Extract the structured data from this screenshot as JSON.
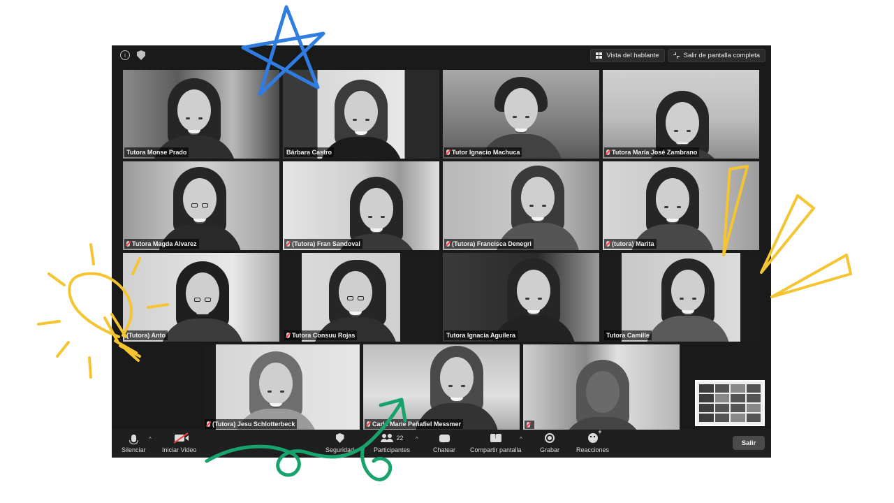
{
  "window": {
    "top_right": {
      "speaker_view_label": "Vista del hablante",
      "exit_fullscreen_label": "Salir de pantalla completa"
    }
  },
  "participants": [
    {
      "name": "Tutora Monse Prado",
      "muted": false
    },
    {
      "name": "Bárbara Castro",
      "muted": false
    },
    {
      "name": "Tutor Ignacio Machuca",
      "muted": true
    },
    {
      "name": "Tutora María José Zambrano",
      "muted": true
    },
    {
      "name": "Tutora Magda Alvarez",
      "muted": true
    },
    {
      "name": "(Tutora) Fran Sandoval",
      "muted": true
    },
    {
      "name": "(Tutora) Francisca Denegri",
      "muted": true
    },
    {
      "name": "(tutora) Marita",
      "muted": true
    },
    {
      "name": "(Tutora) Anto",
      "muted": false
    },
    {
      "name": "Tutora Consuu Rojas",
      "muted": true
    },
    {
      "name": "Tutora Ignacia Aguilera",
      "muted": false
    },
    {
      "name": "Tutora Camille",
      "muted": false
    },
    {
      "name": "(Tutora) Jesu Schlotterbeck",
      "muted": true
    },
    {
      "name": "Carla Marie Peñafiel Messmer",
      "muted": true
    },
    {
      "name": "",
      "muted": true
    }
  ],
  "toolbar": {
    "mute_label": "Silenciar",
    "video_label": "Iniciar Video",
    "security_label": "Seguridad",
    "participants_label": "Participantes",
    "participants_count": "22",
    "chat_label": "Chatear",
    "share_label": "Compartir pantalla",
    "record_label": "Grabar",
    "reactions_label": "Reacciones",
    "leave_label": "Salir"
  },
  "colors": {
    "star": "#2f7de1",
    "bulb": "#f5c431",
    "rays": "#f5c431",
    "arrow": "#17a36b"
  }
}
